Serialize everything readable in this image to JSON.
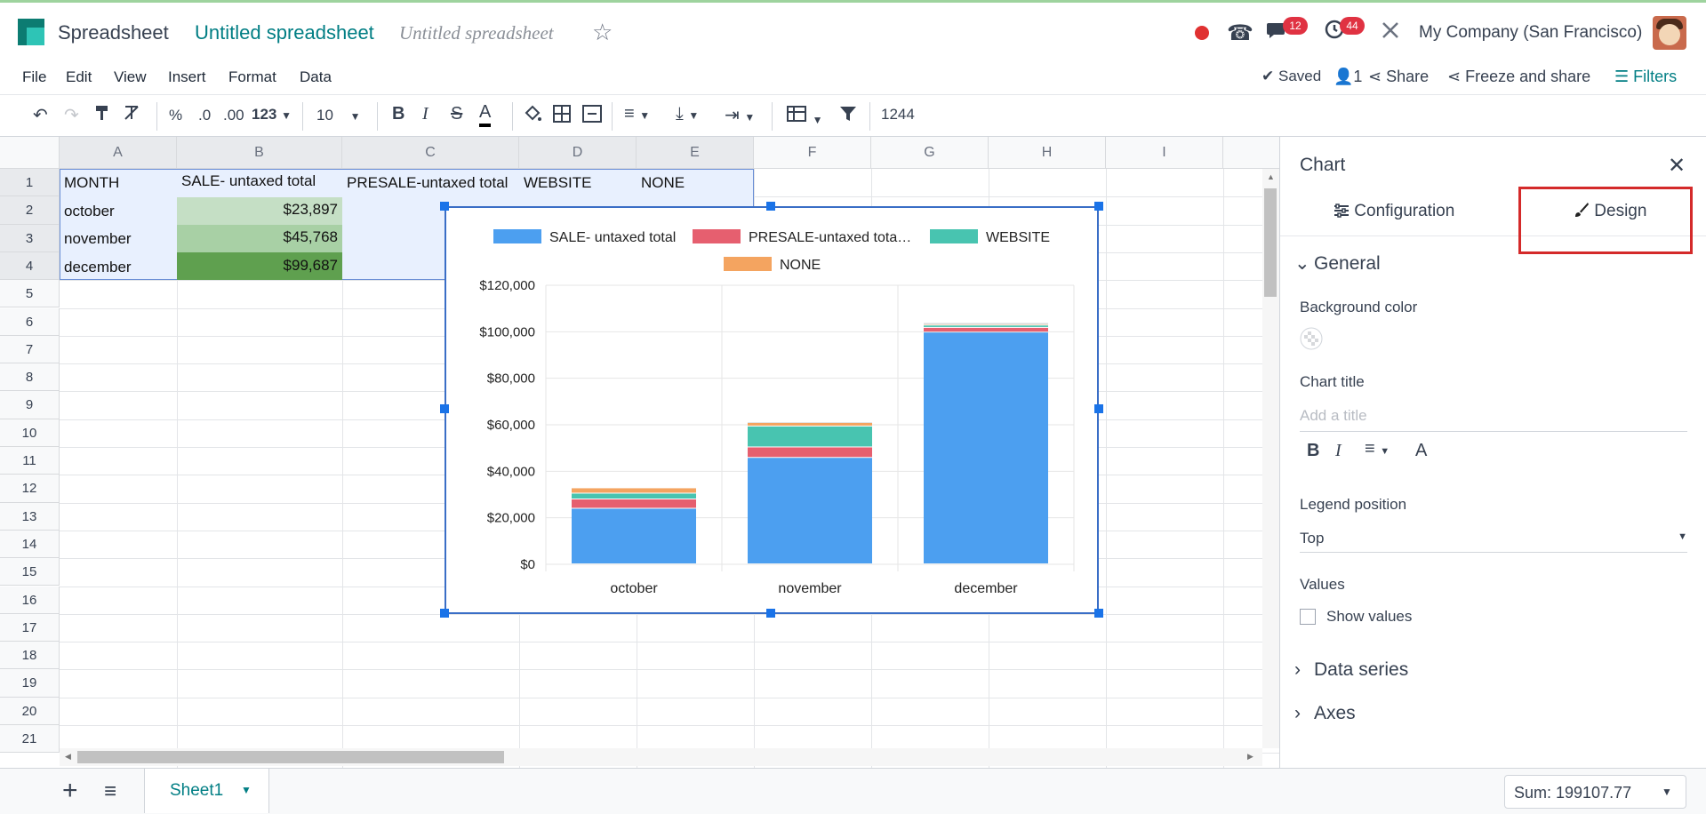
{
  "navbar": {
    "app_name": "Spreadsheet",
    "doc_title": "Untitled spreadsheet",
    "doc_title_placeholder": "Untitled spreadsheet",
    "chat_badge": "12",
    "activity_badge": "44",
    "company": "My Company (San Francisco)"
  },
  "menu": {
    "items": [
      "File",
      "Edit",
      "View",
      "Insert",
      "Format",
      "Data"
    ],
    "saved": "Saved",
    "user_count": "1",
    "share": "Share",
    "freeze_share": "Freeze and share",
    "filters": "Filters"
  },
  "toolbar": {
    "percent": "%",
    "dec_decrease": ".0",
    "dec_increase": ".00",
    "number_format": "123",
    "font_size": "10",
    "bold": "B",
    "italic": "I",
    "strike": "S",
    "text_color": "A",
    "formula_value": "1244"
  },
  "grid": {
    "columns": [
      "A",
      "B",
      "C",
      "D",
      "E",
      "F",
      "G",
      "H",
      "I"
    ],
    "rows": [
      "1",
      "2",
      "3",
      "4",
      "5",
      "6",
      "7",
      "8",
      "9",
      "10",
      "11",
      "12",
      "13",
      "14",
      "15",
      "16",
      "17",
      "18",
      "19",
      "20",
      "21"
    ],
    "cells": {
      "a1": "MONTH",
      "b1": "SALE- untaxed total",
      "c1": "PRESALE-untaxed total",
      "d1": "WEBSITE",
      "e1": "NONE",
      "a2": "october",
      "b2": "$23,897",
      "a3": "november",
      "b3": "$45,768",
      "a4": "december",
      "b4": "$99,687"
    },
    "colors": {
      "b2": "#c5dfc5",
      "b3": "#a8d0a5",
      "b4": "#5fa04f"
    }
  },
  "chart_data": {
    "type": "bar",
    "stacked": true,
    "categories": [
      "october",
      "november",
      "december"
    ],
    "series": [
      {
        "name": "SALE- untaxed total",
        "color": "#4c9ff0",
        "values": [
          23897,
          45768,
          99687
        ]
      },
      {
        "name": "PRESALE-untaxed tota…",
        "color": "#e65f6f",
        "values": [
          4000,
          4500,
          2000
        ]
      },
      {
        "name": "WEBSITE",
        "color": "#48c4b0",
        "values": [
          2500,
          9000,
          1000
        ]
      },
      {
        "name": "NONE",
        "color": "#f4a460",
        "values": [
          2300,
          1500,
          500
        ]
      }
    ],
    "extra_series_top": {
      "color": "#dcdcdc",
      "values": [
        0,
        300,
        600
      ]
    },
    "yticks": [
      "$0",
      "$20,000",
      "$40,000",
      "$60,000",
      "$80,000",
      "$100,000",
      "$120,000"
    ],
    "ylim": [
      0,
      120000
    ],
    "legend_position": "top",
    "grid": true
  },
  "sheet": {
    "tab_name": "Sheet1",
    "sum": "Sum: 199107.77"
  },
  "panel": {
    "title": "Chart",
    "tab_configuration": "Configuration",
    "tab_design": "Design",
    "section_general": "General",
    "background_color": "Background color",
    "chart_title": "Chart title",
    "title_placeholder": "Add a title",
    "fmt_bold": "B",
    "fmt_italic": "I",
    "fmt_color": "A",
    "legend_position": "Legend position",
    "legend_value": "Top",
    "values": "Values",
    "show_values": "Show values",
    "section_data_series": "Data series",
    "section_axes": "Axes"
  }
}
